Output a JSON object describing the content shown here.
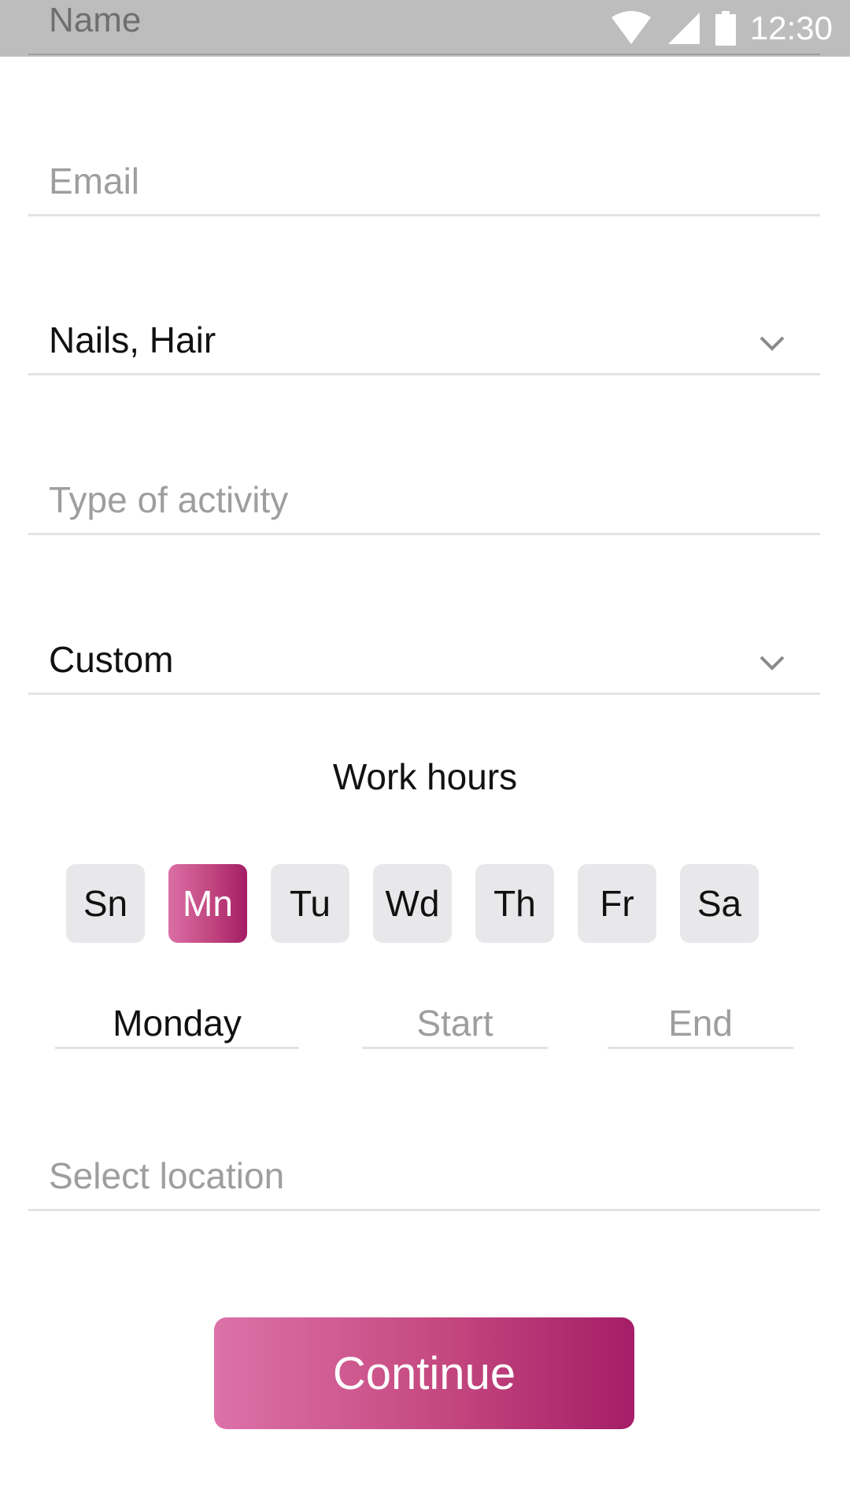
{
  "status_bar": {
    "time": "12:30",
    "icons": [
      "wifi-icon",
      "signal-icon",
      "battery-icon"
    ],
    "background": "#bdbdbd"
  },
  "form": {
    "name_placeholder": "Name",
    "email_placeholder": "Email",
    "category_value": "Nails, Hair",
    "activity_placeholder": "Type of activity",
    "schedule_type_value": "Custom",
    "location_placeholder": "Select location"
  },
  "work_hours": {
    "title": "Work hours",
    "days": [
      {
        "label": "Sn",
        "active": false
      },
      {
        "label": "Mn",
        "active": true
      },
      {
        "label": "Tu",
        "active": false
      },
      {
        "label": "Wd",
        "active": false
      },
      {
        "label": "Th",
        "active": false
      },
      {
        "label": "Fr",
        "active": false
      },
      {
        "label": "Sa",
        "active": false
      }
    ],
    "selected_day": "Monday",
    "start_placeholder": "Start",
    "end_placeholder": "End"
  },
  "actions": {
    "continue_label": "Continue"
  },
  "colors": {
    "accent_start": "#dc72a8",
    "accent_end": "#a51d67",
    "placeholder": "#9e9e9e",
    "divider": "#e3e3e3",
    "chip_bg": "#e8e8ea"
  }
}
